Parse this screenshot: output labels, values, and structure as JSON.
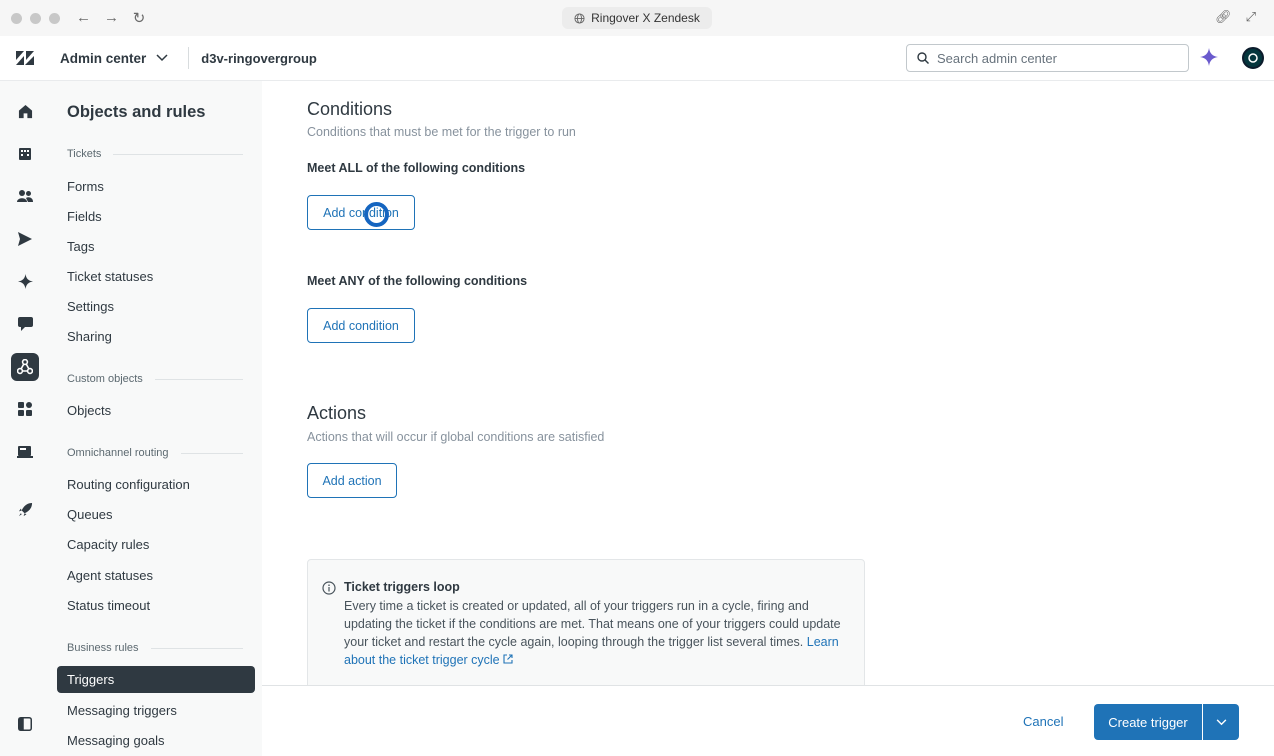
{
  "browser": {
    "tab_title": "Ringover X Zendesk"
  },
  "header": {
    "product": "Admin center",
    "account": "d3v-ringovergroup",
    "search_placeholder": "Search admin center"
  },
  "subnav": {
    "title": "Objects and rules",
    "sections": [
      {
        "label": "Tickets",
        "items": [
          "Forms",
          "Fields",
          "Tags",
          "Ticket statuses",
          "Settings",
          "Sharing"
        ]
      },
      {
        "label": "Custom objects",
        "items": [
          "Objects"
        ]
      },
      {
        "label": "Omnichannel routing",
        "items": [
          "Routing configuration",
          "Queues",
          "Capacity rules",
          "Agent statuses",
          "Status timeout"
        ]
      },
      {
        "label": "Business rules",
        "items": [
          "Triggers",
          "Messaging triggers",
          "Messaging goals"
        ]
      }
    ],
    "active_item": "Triggers"
  },
  "conditions": {
    "heading": "Conditions",
    "description": "Conditions that must be met for the trigger to run",
    "all_label": "Meet ALL of the following conditions",
    "any_label": "Meet ANY of the following conditions",
    "add_condition": "Add condition"
  },
  "actions": {
    "heading": "Actions",
    "description": "Actions that will occur if global conditions are satisfied",
    "add_action": "Add action"
  },
  "notice": {
    "title": "Ticket triggers loop",
    "body": "Every time a ticket is created or updated, all of your triggers run in a cycle, firing and updating the ticket if the conditions are met. That means one of your triggers could update your ticket and restart the cycle again, looping through the trigger list several times.",
    "link": "Learn about the ticket trigger cycle"
  },
  "footer": {
    "cancel": "Cancel",
    "create": "Create trigger"
  },
  "colors": {
    "primary": "#1f73b7",
    "nav_active": "#2f3941",
    "cursor": "#1565c0"
  }
}
